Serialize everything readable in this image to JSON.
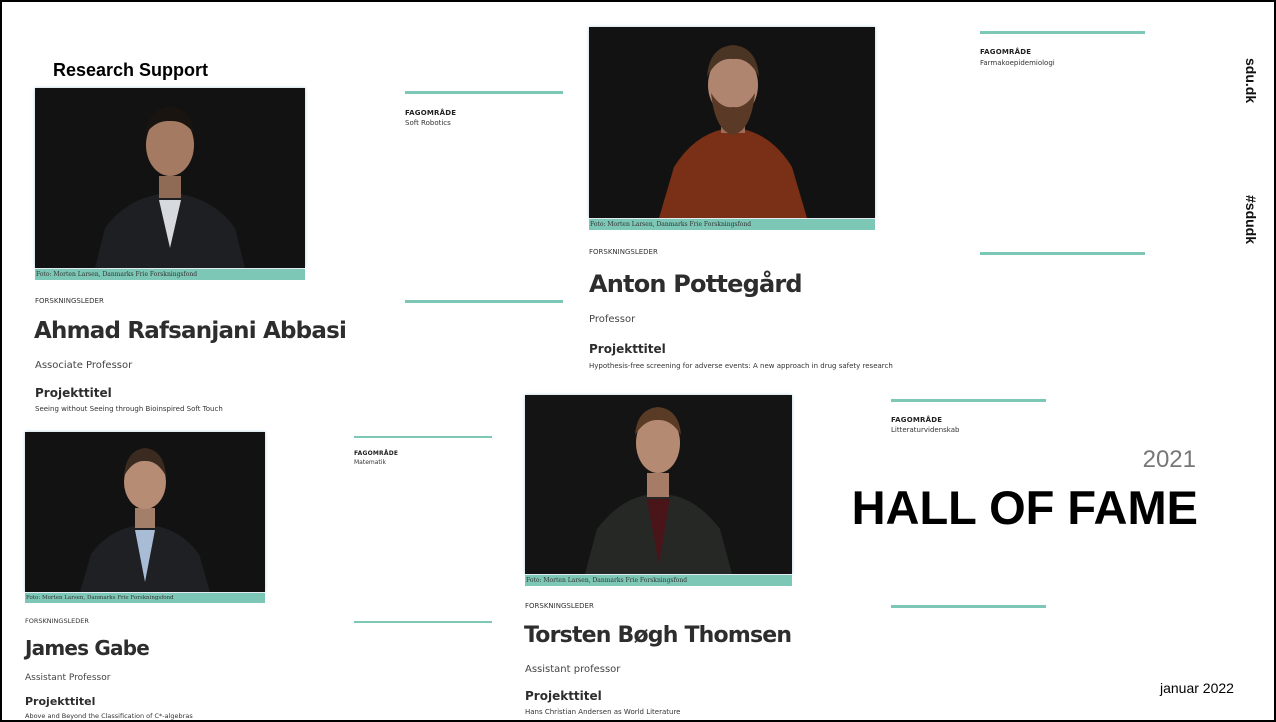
{
  "header": {
    "title": "Research Support"
  },
  "side": {
    "site": "sdu.dk",
    "hashtag": "#sdudk"
  },
  "hall": {
    "year": "2021",
    "title": "HALL OF FAME"
  },
  "footer": {
    "date": "januar 2022"
  },
  "labels": {
    "field": "FAGOMRÅDE",
    "role": "FORSKNINGSLEDER",
    "project": "Projekttitel"
  },
  "photo_credit": "Foto: Morten Larsen, Danmarks Frie Forskningsfond",
  "researchers": [
    {
      "name": "Ahmad Rafsanjani Abbasi",
      "title": "Associate Professor",
      "field": "Soft Robotics",
      "project": "Seeing without Seeing through Bioinspired Soft Touch"
    },
    {
      "name": "Anton Pottegård",
      "title": "Professor",
      "field": "Farmakoepidemiologi",
      "project": "Hypothesis-free screening for adverse events: A new approach in drug safety research"
    },
    {
      "name": "James Gabe",
      "title": "Assistant Professor",
      "field": "Matematik",
      "project": "Above and Beyond the Classification of C*-algebras"
    },
    {
      "name": "Torsten Bøgh Thomsen",
      "title": "Assistant professor",
      "field": "Litteraturvidenskab",
      "project": "Hans Christian Andersen as World Literature"
    }
  ],
  "colors": {
    "accent": "#7cc7b5",
    "text": "#2d2d2d",
    "photo_bg": "#131313"
  }
}
